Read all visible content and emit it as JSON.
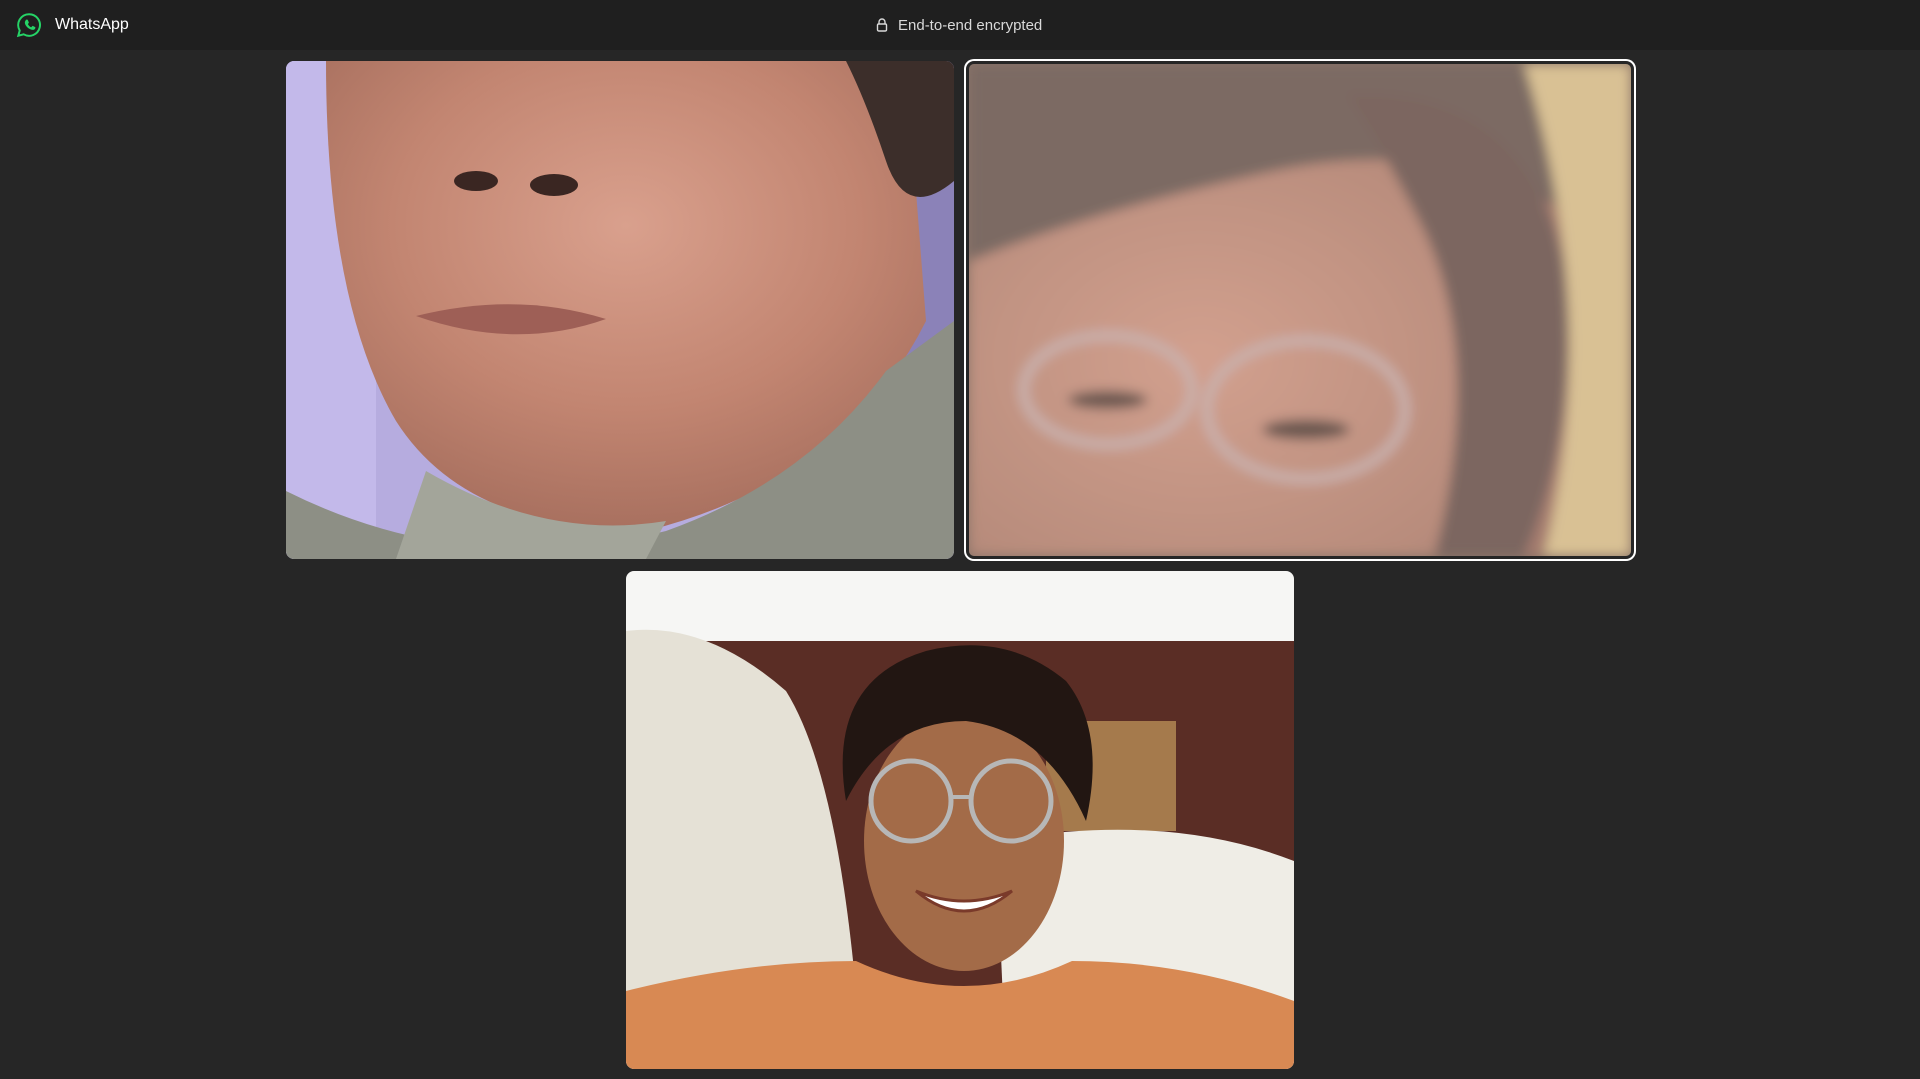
{
  "window": {
    "app_name": "WhatsApp",
    "encryption_label": "End-to-end encrypted",
    "app_icon": "whatsapp-logo-icon",
    "lock_icon": "lock-icon"
  },
  "call": {
    "participants": [
      {
        "tile_name": "participant-video-1",
        "active_speaker": false
      },
      {
        "tile_name": "participant-video-2",
        "active_speaker": true
      },
      {
        "tile_name": "self-video",
        "active_speaker": false
      }
    ]
  },
  "colors": {
    "titlebar_bg": "#1f1f1f",
    "stage_bg": "#262626",
    "whatsapp_green": "#25d366",
    "active_border": "#ffffff"
  }
}
